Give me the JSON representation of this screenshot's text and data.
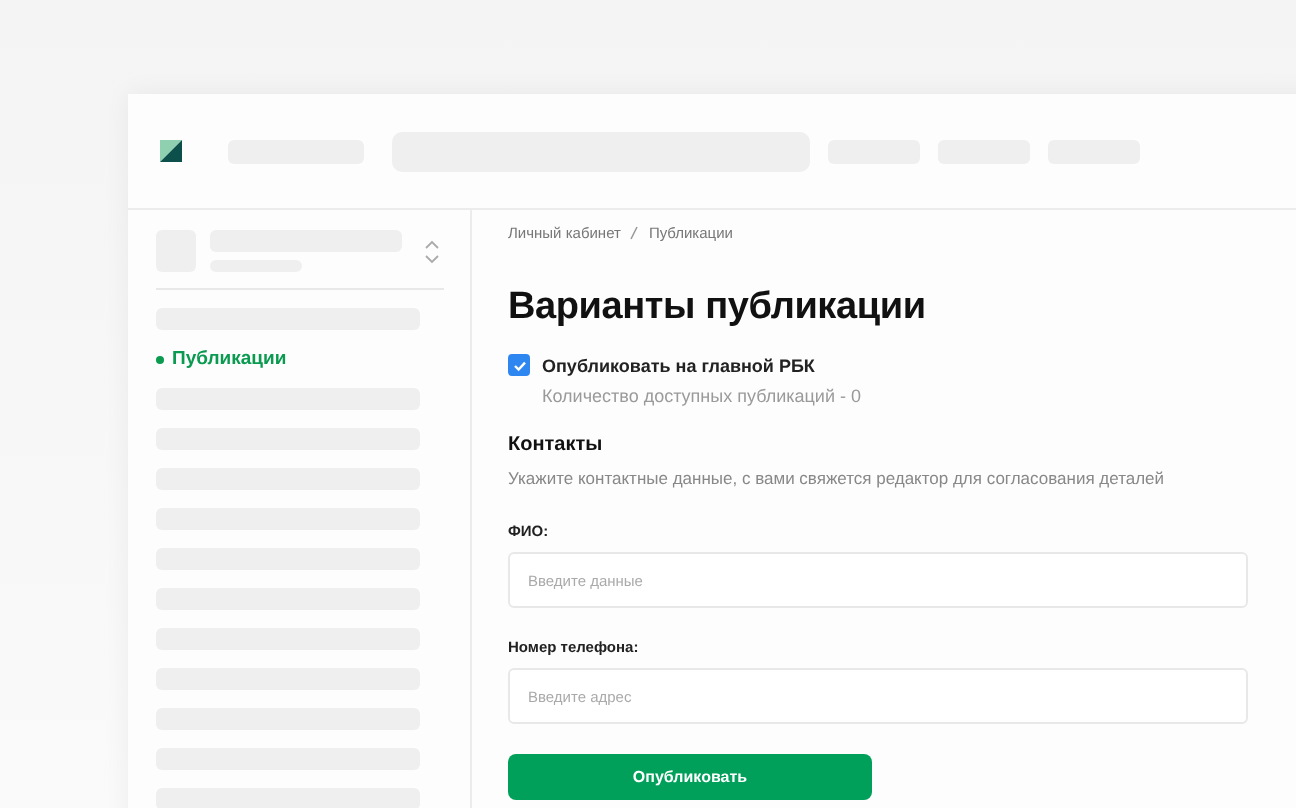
{
  "header": {
    "skeletons": [
      {
        "kind": "logo"
      },
      {
        "kind": "bar"
      },
      {
        "kind": "search"
      },
      {
        "kind": "bar"
      },
      {
        "kind": "bar"
      },
      {
        "kind": "bar"
      }
    ]
  },
  "sidebar": {
    "items": [
      {
        "kind": "skeleton"
      },
      {
        "kind": "link",
        "label": "Публикации",
        "selected": true
      },
      {
        "kind": "skeleton"
      },
      {
        "kind": "skeleton"
      },
      {
        "kind": "skeleton"
      },
      {
        "kind": "skeleton"
      },
      {
        "kind": "skeleton"
      },
      {
        "kind": "skeleton"
      },
      {
        "kind": "skeleton"
      },
      {
        "kind": "skeleton"
      },
      {
        "kind": "skeleton"
      },
      {
        "kind": "skeleton"
      },
      {
        "kind": "skeleton"
      }
    ]
  },
  "breadcrumbs": [
    "Личный кабинет",
    "Публикации"
  ],
  "title": "Варианты публикации",
  "option": {
    "label": "Опубликовать на главной РБК",
    "checked": true,
    "hint": "Количество доступных публикаций - 0"
  },
  "contacts": {
    "heading": "Контакты",
    "description": "Укажите контактные данные, с вами свяжется редактор для согласования деталей",
    "fields": [
      {
        "label": "ФИО:",
        "placeholder": "Введите данные"
      },
      {
        "label": "Номер телефона:",
        "placeholder": "Введите адрес"
      }
    ]
  },
  "submit": "Опубликовать"
}
